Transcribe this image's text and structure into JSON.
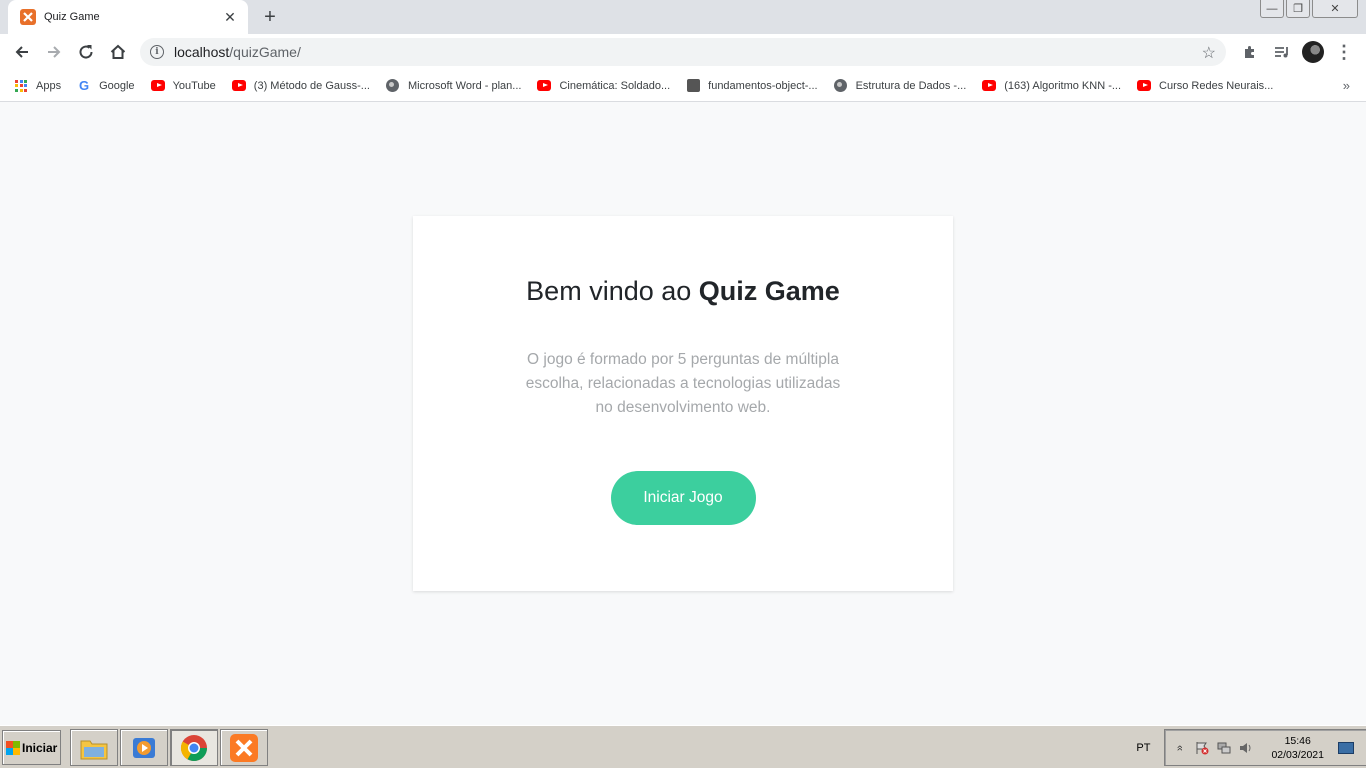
{
  "browser": {
    "tab": {
      "title": "Quiz Game",
      "favicon": "xampp-icon",
      "close": "✕"
    },
    "new_tab": "+",
    "window_controls": {
      "minimize": "—",
      "restore": "❐",
      "close": "✕"
    },
    "address": {
      "host": "localhost",
      "path": "/quizGame/"
    }
  },
  "bookmarks": [
    {
      "label": "Apps",
      "icon": "apps-icon"
    },
    {
      "label": "Google",
      "icon": "google-icon"
    },
    {
      "label": "YouTube",
      "icon": "youtube-icon"
    },
    {
      "label": "(3) Método de Gauss-...",
      "icon": "youtube-icon"
    },
    {
      "label": "Microsoft Word - plan...",
      "icon": "globe-icon"
    },
    {
      "label": "Cinemática: Soldado...",
      "icon": "youtube-icon"
    },
    {
      "label": "fundamentos-object-...",
      "icon": "misc-icon"
    },
    {
      "label": "Estrutura de Dados -...",
      "icon": "globe-icon"
    },
    {
      "label": "(163) Algoritmo KNN -...",
      "icon": "youtube-icon"
    },
    {
      "label": "Curso Redes Neurais...",
      "icon": "youtube-icon"
    }
  ],
  "bookmarks_more": "»",
  "page": {
    "title_prefix": "Bem vindo ao ",
    "title_bold": "Quiz Game",
    "description": "O jogo é formado por 5 perguntas de múltipla escolha, relacionadas a tecnologias utilizadas no desenvolvimento web.",
    "start_button": "Iniciar Jogo",
    "accent_color": "#3ccf9e"
  },
  "taskbar": {
    "start_label": "Iniciar",
    "language": "PT",
    "time": "15:46",
    "date": "02/03/2021",
    "expand": "»"
  }
}
